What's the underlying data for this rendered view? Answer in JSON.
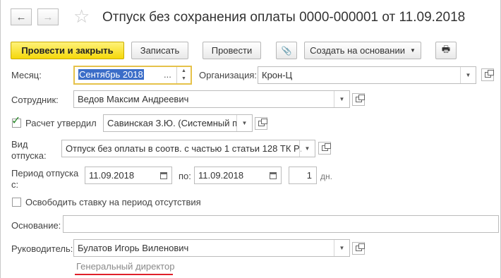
{
  "title": "Отпуск без сохранения оплаты 0000-000001 от 11.09.2018",
  "nav": {
    "back_icon": "←",
    "forward_icon": "→",
    "star_icon": "☆"
  },
  "toolbar": {
    "post_close": "Провести и закрыть",
    "save": "Записать",
    "post": "Провести",
    "attach_icon": "📎",
    "create_based": "Создать на основании",
    "print_icon": "🖶"
  },
  "form": {
    "month_label": "Месяц:",
    "month_value": "Сентябрь 2018",
    "month_ellipsis": "...",
    "org_label": "Организация:",
    "org_value": "Крон-Ц",
    "employee_label": "Сотрудник:",
    "employee_value": "Ведов Максим Андреевич",
    "approved_label": "Расчет утвердил",
    "approved_value": "Савинская З.Ю. (Системный п",
    "leave_type_label_1": "Вид",
    "leave_type_label_2": "отпуска:",
    "leave_type_value": "Отпуск без оплаты в соотв. с частью 1 статьи 128 ТК Р…",
    "period_label_1": "Период отпуска",
    "period_label_2": "с:",
    "period_from": "11.09.2018",
    "period_to_label": "по:",
    "period_to": "11.09.2018",
    "days_value": "1",
    "days_unit": "дн.",
    "release_rate_label": "Освободить ставку на период отсутствия",
    "basis_label": "Основание:",
    "basis_value": "",
    "manager_label": "Руководитель:",
    "manager_value": "Булатов Игорь Виленович",
    "manager_position": "Генеральный директор"
  },
  "colors": {
    "accent_yellow": "#f5d80a",
    "focus_border": "#e6c24a",
    "underline_red": "#e0202a",
    "check_green": "#2e8b2e"
  }
}
